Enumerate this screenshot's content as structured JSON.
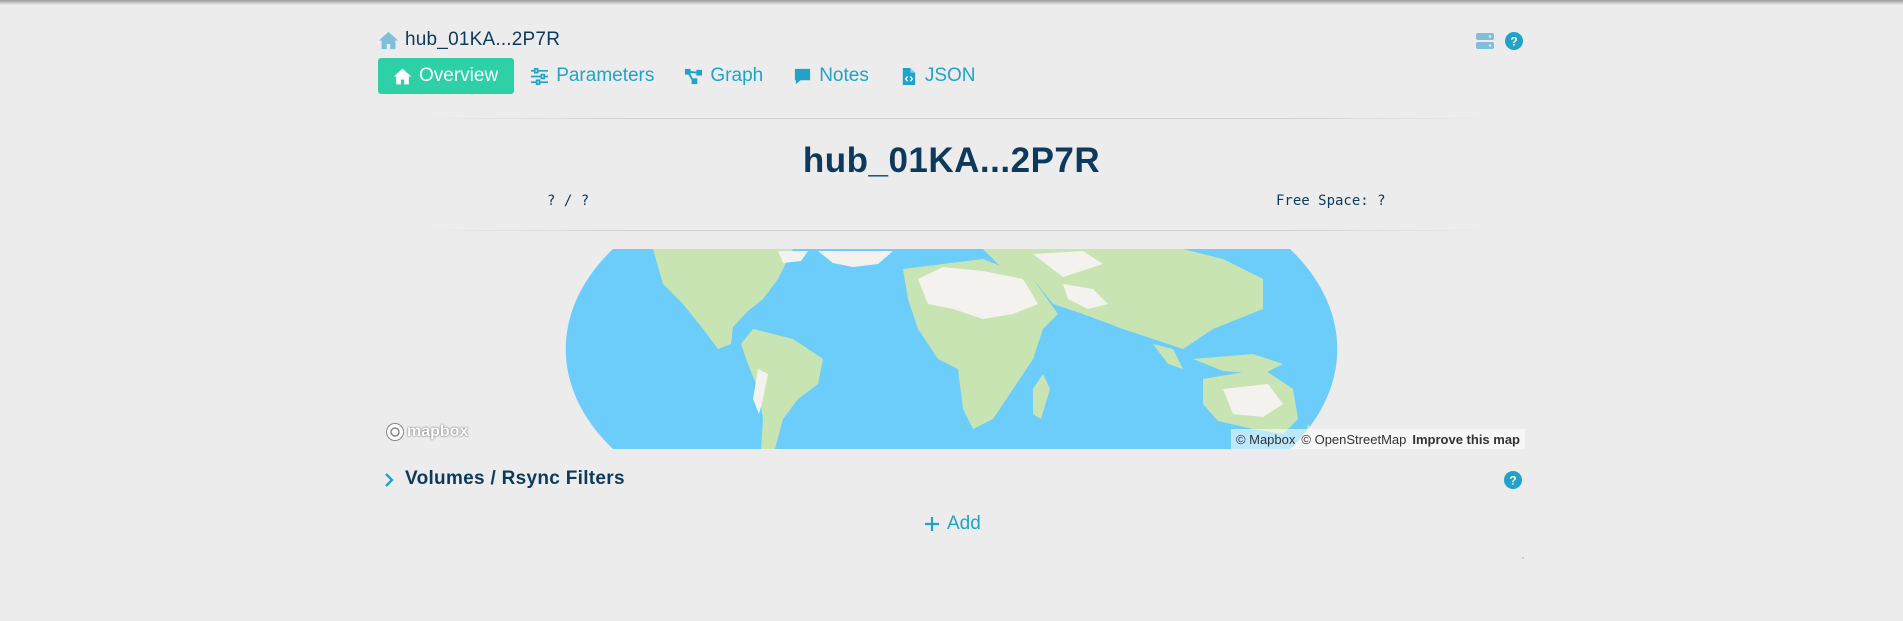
{
  "breadcrumb": {
    "icon": "home-icon",
    "text": "hub_01KA...2P7R"
  },
  "tabs": [
    {
      "label": "Overview",
      "icon": "home-icon",
      "active": true
    },
    {
      "label": "Parameters",
      "icon": "sliders-icon"
    },
    {
      "label": "Graph",
      "icon": "graph-icon"
    },
    {
      "label": "Notes",
      "icon": "comment-icon"
    },
    {
      "label": "JSON",
      "icon": "file-code-icon"
    }
  ],
  "header": {
    "title": "hub_01KA...2P7R",
    "usage": "? / ?",
    "free_space": "Free Space: ?"
  },
  "map": {
    "logo_text": "mapbox",
    "attribution": [
      "© Mapbox",
      "© OpenStreetMap"
    ],
    "improve_link": "Improve this map"
  },
  "section": {
    "title": "Volumes / Rsync Filters"
  },
  "add_label": "Add",
  "colors": {
    "accent": "#21a3c9",
    "active_tab": "#2ed0a6",
    "text_dark": "#0d3a5c",
    "ocean": "#6ccdfb",
    "land": "#c8e4b2",
    "desert": "#f4f2ef",
    "background": "#ececec"
  }
}
